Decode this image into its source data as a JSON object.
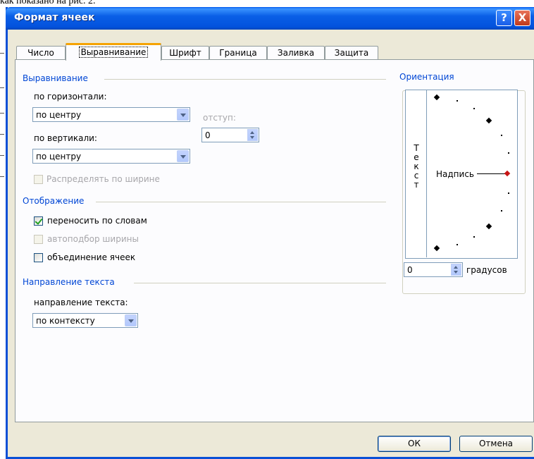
{
  "background": {
    "text": "как показано на рис. 2."
  },
  "window": {
    "title": "Формат ячеек",
    "help_label": "?",
    "close_label": "X"
  },
  "tabs": [
    {
      "label": "Число"
    },
    {
      "label": "Выравнивание"
    },
    {
      "label": "Шрифт"
    },
    {
      "label": "Граница"
    },
    {
      "label": "Заливка"
    },
    {
      "label": "Защита"
    }
  ],
  "alignment": {
    "group": "Выравнивание",
    "horizontal_label": "по горизонтали:",
    "horizontal_value": "по центру",
    "indent_label": "отступ:",
    "indent_value": "0",
    "vertical_label": "по вертикали:",
    "vertical_value": "по центру",
    "distribute_label": "Распределять по ширине"
  },
  "display": {
    "group": "Отображение",
    "wrap_label": "переносить по словам",
    "wrap_checked": true,
    "shrink_label": "автоподбор ширины",
    "shrink_checked": false,
    "merge_label": "объединение ячеек",
    "merge_checked": false
  },
  "direction": {
    "group": "Направление текста",
    "label": "направление текста:",
    "value": "по контексту"
  },
  "orientation": {
    "group": "Ориентация",
    "vertical_text": "Текст",
    "sample_label": "Надпись",
    "degrees_value": "0",
    "degrees_label": "градусов"
  },
  "buttons": {
    "ok": "ОК",
    "cancel": "Отмена"
  },
  "colors": {
    "title_bar": "#0a5fe6",
    "group_label": "#0046d5",
    "active_tab_accent": "#f5a300",
    "dialog_bg": "#ece9d8"
  }
}
